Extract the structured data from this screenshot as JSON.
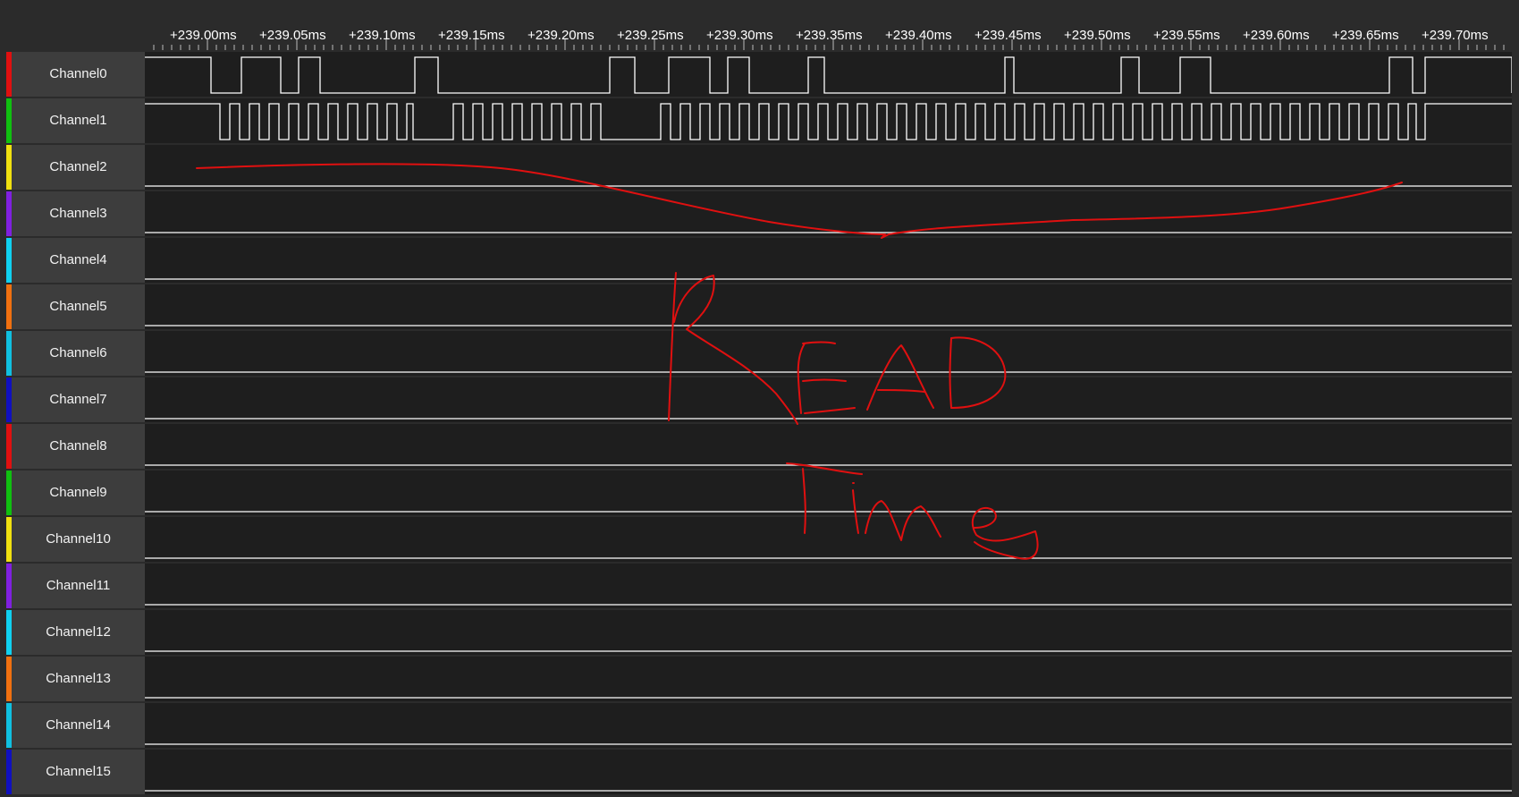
{
  "timeline": {
    "ticks": [
      "+239.00ms",
      "+239.05ms",
      "+239.10ms",
      "+239.15ms",
      "+239.20ms",
      "+239.25ms",
      "+239.30ms",
      "+239.35ms",
      "+239.40ms",
      "+239.45ms",
      "+239.50ms",
      "+239.55ms",
      "+239.60ms",
      "+239.65ms",
      "+239.70ms"
    ]
  },
  "channels": [
    {
      "label": "Channel0",
      "color": "#e01010"
    },
    {
      "label": "Channel1",
      "color": "#10c010"
    },
    {
      "label": "Channel2",
      "color": "#f0e010"
    },
    {
      "label": "Channel3",
      "color": "#8020e0"
    },
    {
      "label": "Channel4",
      "color": "#10d0f0"
    },
    {
      "label": "Channel5",
      "color": "#f07010"
    },
    {
      "label": "Channel6",
      "color": "#10c0e0"
    },
    {
      "label": "Channel7",
      "color": "#1010c0"
    },
    {
      "label": "Channel8",
      "color": "#e01010"
    },
    {
      "label": "Channel9",
      "color": "#10c010"
    },
    {
      "label": "Channel10",
      "color": "#f0e010"
    },
    {
      "label": "Channel11",
      "color": "#8020e0"
    },
    {
      "label": "Channel12",
      "color": "#10d0f0"
    },
    {
      "label": "Channel13",
      "color": "#f07010"
    },
    {
      "label": "Channel14",
      "color": "#10c0e0"
    },
    {
      "label": "Channel15",
      "color": "#1010c0"
    }
  ],
  "annotation": {
    "color": "#e01010"
  },
  "theme": {
    "trace_color": "#ffffff",
    "background": "#2b2b2b",
    "trace_background": "#1e1e1e"
  }
}
